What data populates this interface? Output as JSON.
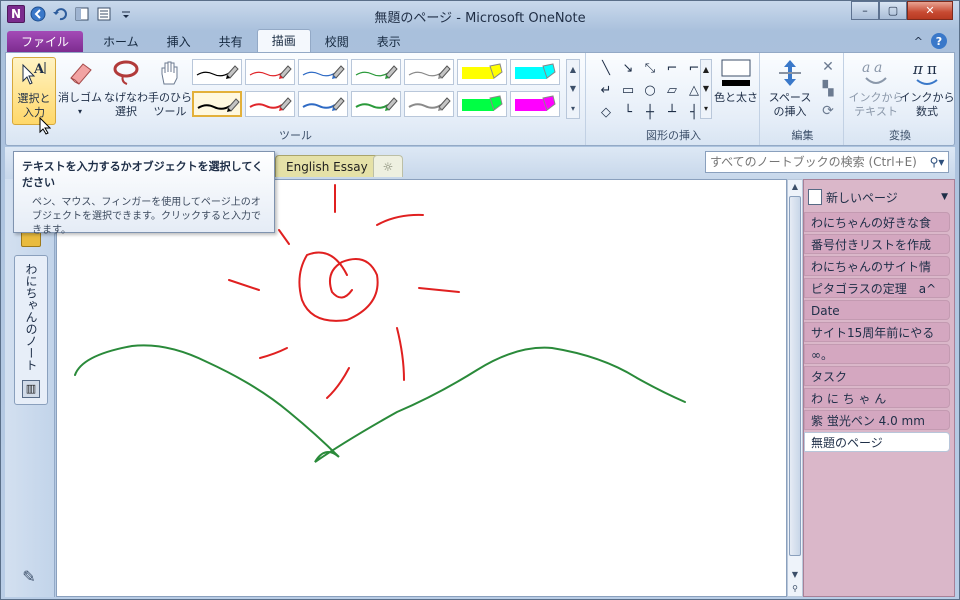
{
  "window": {
    "title": "無題のページ - Microsoft OneNote",
    "app_logo": "N",
    "controls": {
      "minimize": "–",
      "maximize": "▢",
      "close": "✕"
    }
  },
  "quick_access": {
    "icons": [
      "back-icon",
      "undo-icon",
      "dock-icon",
      "view-icon",
      "customize-icon"
    ]
  },
  "tabs": {
    "file": "ファイル",
    "items": [
      "ホーム",
      "挿入",
      "共有",
      "描画",
      "校閲",
      "表示"
    ],
    "active": "描画",
    "collapse": "^",
    "help": "?"
  },
  "ribbon": {
    "tools_group": "ツール",
    "select_and_type": "選択と\n入力",
    "eraser": "消しゴム",
    "lasso": "なげなわ\n選択",
    "panning": "手のひら\nツール",
    "pen_colors": {
      "row1": [
        "#000000",
        "#e0252a",
        "#2e6ac4",
        "#2a9a3a",
        "#8a8a8a",
        "#ffff00",
        "#00ffff"
      ],
      "row2": [
        "#000000",
        "#e0252a",
        "#2e6ac4",
        "#2a9a3a",
        "#8a8a8a",
        "#00ff44",
        "#ff00ff"
      ]
    },
    "shapes_group": "図形の挿入",
    "color_and_thickness": "色と太さ",
    "edit_group": "編集",
    "insert_space": "スペース\nの挿入",
    "convert_group": "変換",
    "ink_to_text": "インクから\nテキスト",
    "ink_to_math": "インクから\n数式"
  },
  "notebook": {
    "section_tab": "English Essay",
    "new_section": "☼",
    "search_placeholder": "すべてのノートブックの検索 (Ctrl+E)",
    "notebook_name": "わにちゃんのノート"
  },
  "pages": {
    "new_page": "新しいページ",
    "items": [
      "わにちゃんの好きな食",
      "番号付きリストを作成",
      "わにちゃんのサイト情",
      "ピタゴラスの定理　a^",
      "Date",
      "サイト15周年前にやる",
      "∞。",
      "タスク",
      "わ に ち ゃ ん",
      "紫 蛍光ペン 4.0 mm",
      "無題のページ"
    ],
    "selected": "無題のページ"
  },
  "tooltip": {
    "title": "テキストを入力するかオブジェクトを選択してください",
    "body": "ペン、マウス、フィンガーを使用してページ上のオブジェクトを選択できます。クリックすると入力できます。"
  },
  "colors": {
    "sun": "#e02020",
    "hills": "#2a8a3a",
    "page_list_bg": "#dab7c9",
    "onenote_purple": "#7b2b8e"
  }
}
